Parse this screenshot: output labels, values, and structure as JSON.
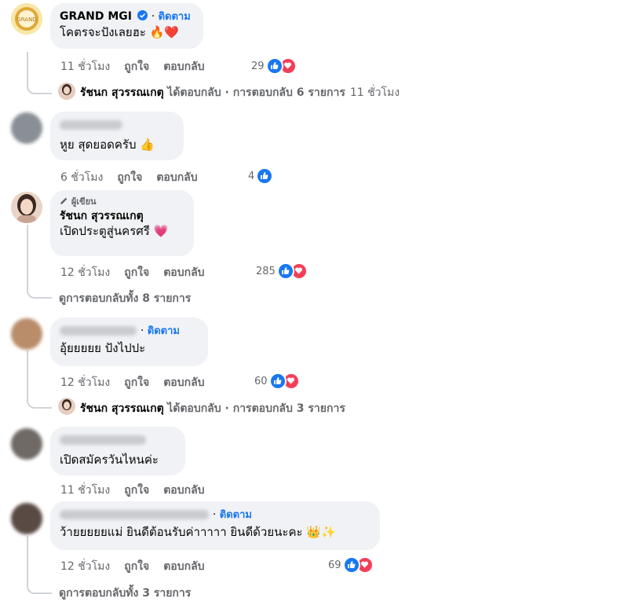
{
  "comments": [
    {
      "author": "GRAND MGI",
      "follow": "ติดตาม",
      "text": "โคตรจะปังเลยฮะ",
      "emoji": "🔥❤️",
      "time": "11 ชั่วโมง",
      "like": "ถูกใจ",
      "reply": "ตอบกลับ",
      "reactions": "29",
      "reply_summary": {
        "name": "รัชนก สุวรรณเกตุ",
        "text": "ได้ตอบกลับ · การตอบกลับ 6 รายการ",
        "time": "11 ชั่วโมง"
      }
    },
    {
      "text": "หูย สุดยอดครับ",
      "emoji": "👍",
      "time": "6 ชั่วโมง",
      "like": "ถูกใจ",
      "reply": "ตอบกลับ",
      "reactions": "4"
    },
    {
      "badge": "ผู้เขียน",
      "author": "รัชนก สุวรรณเกตุ",
      "text": "เปิดประตูสู่นครศรี",
      "emoji": "💗",
      "time": "12 ชั่วโมง",
      "like": "ถูกใจ",
      "reply": "ตอบกลับ",
      "reactions": "285",
      "see_all": "ดูการตอบกลับทั้ง 8 รายการ"
    },
    {
      "follow": "ติดตาม",
      "text": "อุ้ยยยยย ปังไปปะ",
      "time": "12 ชั่วโมง",
      "like": "ถูกใจ",
      "reply": "ตอบกลับ",
      "reactions": "60",
      "reply_summary": {
        "name": "รัชนก สุวรรณเกตุ",
        "text": "ได้ตอบกลับ · การตอบกลับ 3 รายการ"
      }
    },
    {
      "text": "เปิดสมัครวันไหนค่ะ",
      "time": "11 ชั่วโมง",
      "like": "ถูกใจ",
      "reply": "ตอบกลับ"
    },
    {
      "follow": "ติดตาม",
      "text": "ว้ายยยยยแม่ ยินดีต้อนรับค่าาาาา ยินดีด้วยนะคะ",
      "emoji": "👑✨",
      "time": "12 ชั่วโมง",
      "like": "ถูกใจ",
      "reply": "ตอบกลับ",
      "reactions": "69",
      "see_all": "ดูการตอบกลับทั้ง 3 รายการ"
    }
  ],
  "colors": {
    "bubble": "#f0f2f5",
    "link": "#1877f2",
    "meta": "#65676b",
    "like": "#1877f2",
    "love": "#f33e58"
  },
  "icons": [
    "verified-badge-icon",
    "like-reaction-icon",
    "love-reaction-icon",
    "pencil-icon"
  ]
}
